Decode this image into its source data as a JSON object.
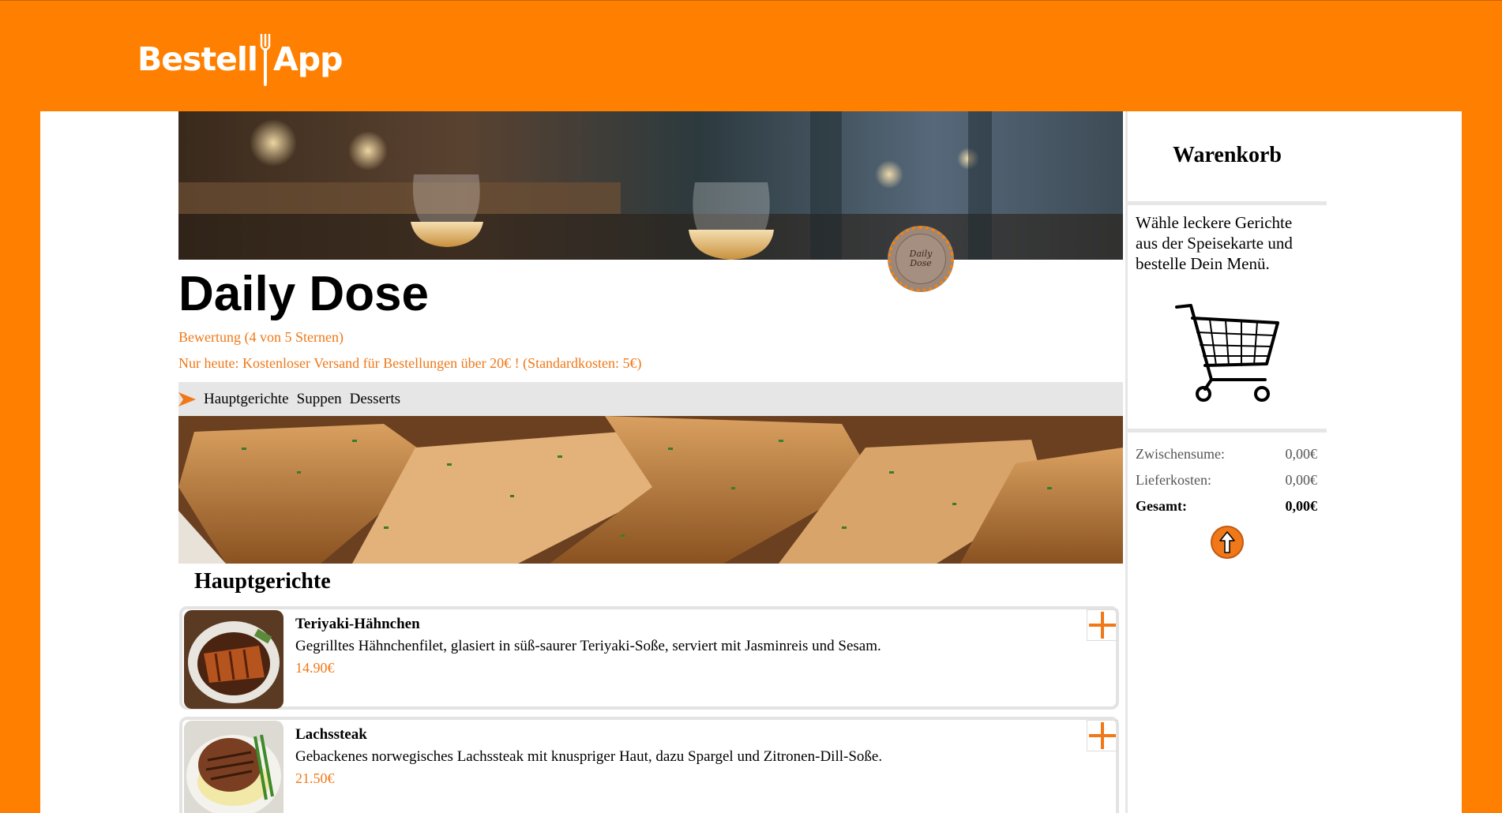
{
  "app": {
    "brand_left": "Bestell",
    "brand_right": "App"
  },
  "restaurant": {
    "name": "Daily Dose",
    "logo_text_1": "Daily",
    "logo_text_2": "Dose",
    "rating": "Bewertung (4 von 5 Sternen)",
    "promo": "Nur heute: Kostenloser Versand für Bestellungen über 20€ ! (Standardkosten: 5€)"
  },
  "categories": [
    "Hauptgerichte",
    "Suppen",
    "Desserts"
  ],
  "section": {
    "title": "Hauptgerichte"
  },
  "dishes": [
    {
      "name": "Teriyaki-Hähnchen",
      "description": "Gegrilltes Hähnchenfilet, glasiert in süß-saurer Teriyaki-Soße, serviert mit Jasminreis und Sesam.",
      "price": "14.90€"
    },
    {
      "name": "Lachssteak",
      "description": "Gebackenes norwegisches Lachssteak mit knuspriger Haut, dazu Spargel und Zitronen-Dill-Soße.",
      "price": "21.50€"
    }
  ],
  "cart": {
    "title": "Warenkorb",
    "message": "Wähle leckere Gerichte aus der Speisekarte und bestelle Dein Menü.",
    "subtotal_label": "Zwischensume:",
    "subtotal_value": "0,00€",
    "delivery_label": "Lieferkosten:",
    "delivery_value": "0,00€",
    "total_label": "Gesamt:",
    "total_value": "0,00€"
  },
  "colors": {
    "brand": "#ff8000",
    "accent": "#f07818",
    "divider": "#e6e6e6"
  },
  "icons": {
    "logo": "fork-knife-icon",
    "nav_arrow": "arrow-right-icon",
    "add": "plus-icon",
    "cart": "shopping-cart-icon",
    "scroll_up": "arrow-up-icon"
  }
}
